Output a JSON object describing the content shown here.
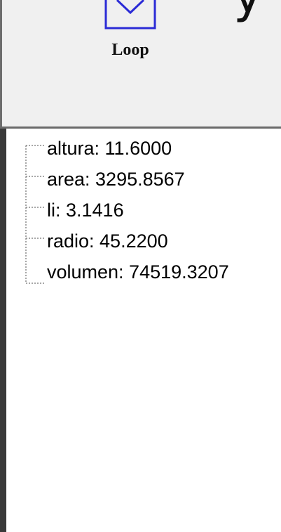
{
  "toolbar": {
    "loop_button": {
      "label": "Loop",
      "icon": "loop-icon"
    },
    "partial_glyph": "y"
  },
  "variables_tree": {
    "items": [
      {
        "text": "altura: 11.6000"
      },
      {
        "text": "area: 3295.8567"
      },
      {
        "text": "li: 3.1416"
      },
      {
        "text": "radio: 45.2200"
      },
      {
        "text": "volumen: 74519.3207"
      }
    ]
  },
  "colors": {
    "icon_stroke": "#2b2bd6",
    "panel_bg": "#ffffff",
    "window_bg": "#f0f0f0",
    "tree_line": "#8a8a8a"
  }
}
